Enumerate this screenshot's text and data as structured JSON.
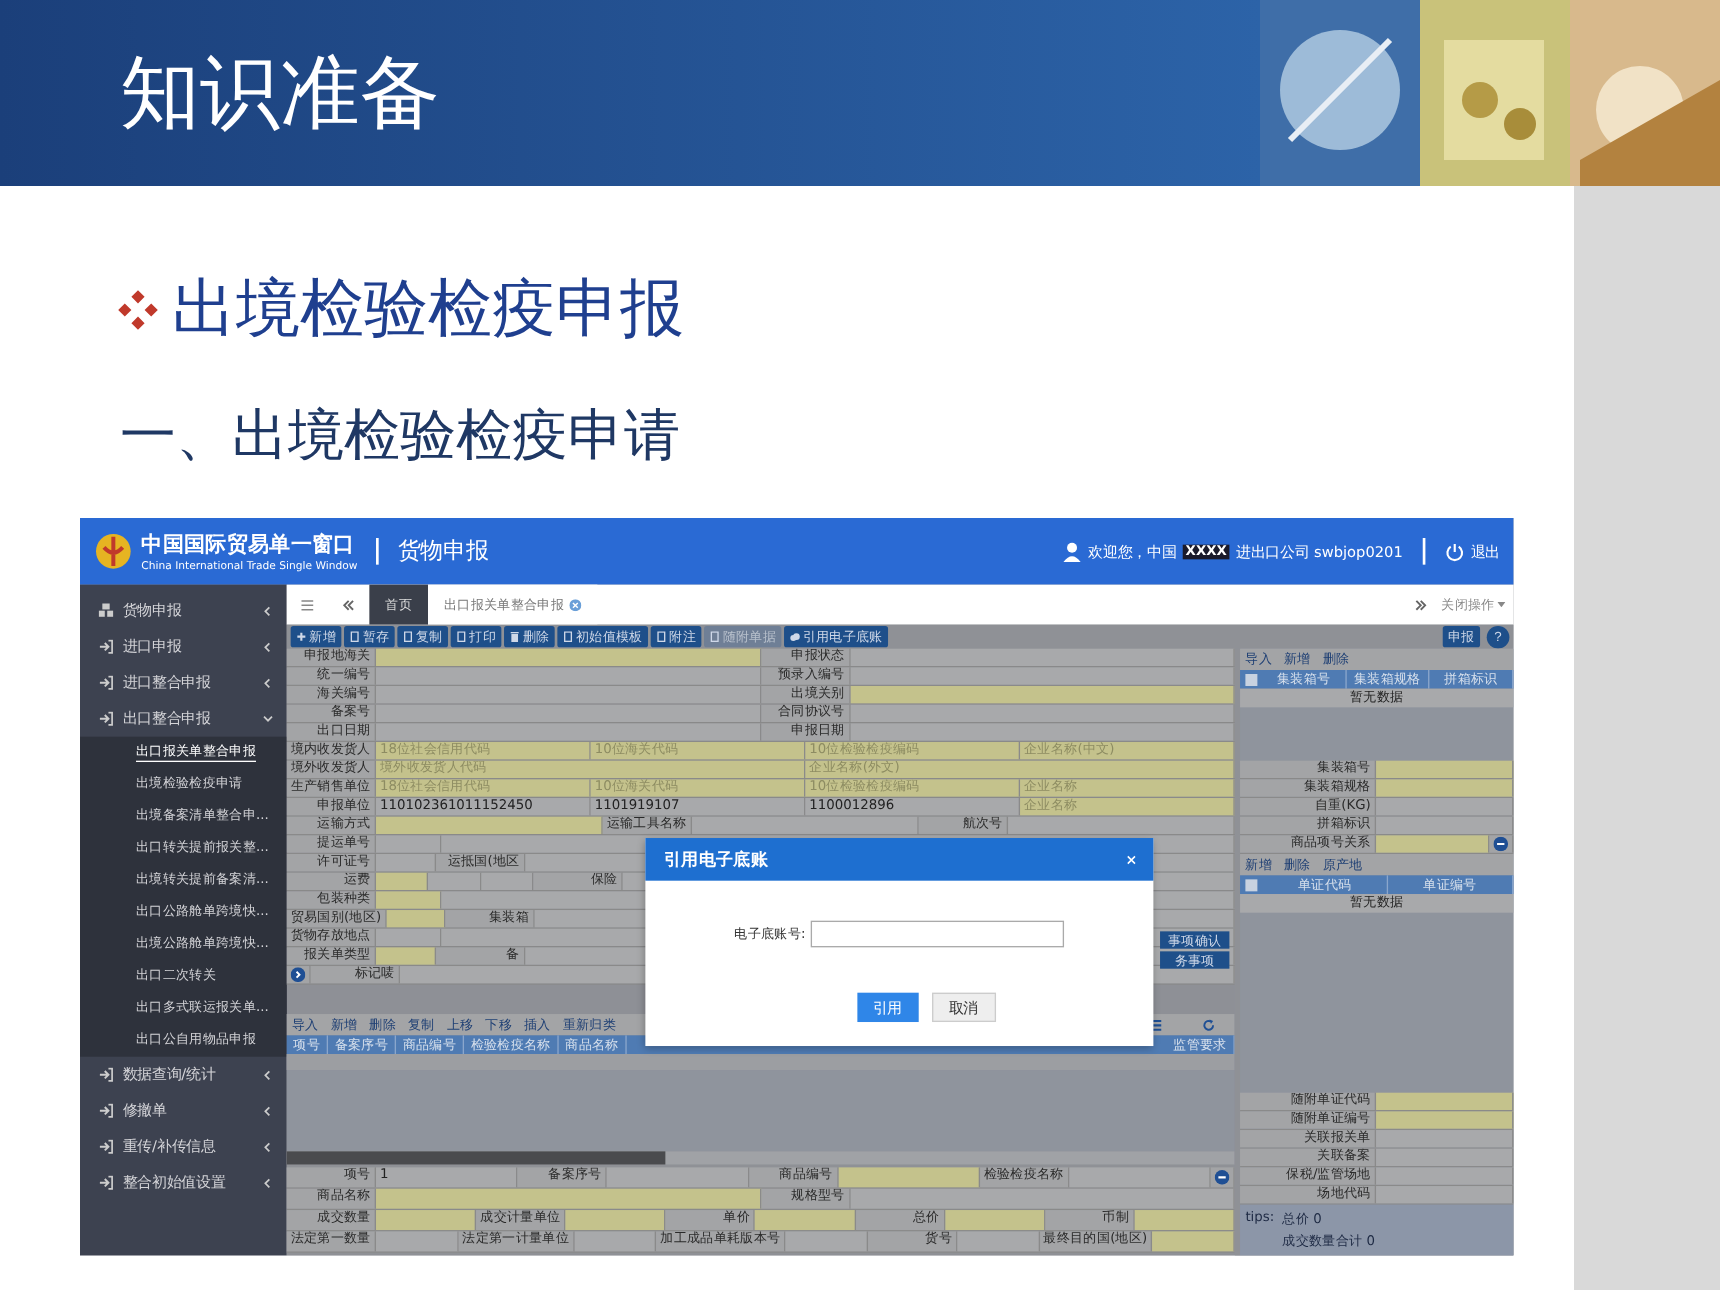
{
  "slide": {
    "title": "知识准备",
    "heading": "出境检验检疫申报",
    "subheading": "一、出境检验检疫申请"
  },
  "app": {
    "header": {
      "brand": "中国国际贸易单一窗口",
      "brand_en": "China International Trade Single Window",
      "module": "货物申报",
      "welcome": "欢迎您，中国",
      "masked": "XXXX",
      "account": "进出口公司 swbjop0201",
      "logout": "退出"
    },
    "sidebar": {
      "items": [
        {
          "label": "货物申报",
          "expanded": false
        },
        {
          "label": "进口申报",
          "expanded": false
        },
        {
          "label": "进口整合申报",
          "expanded": false
        },
        {
          "label": "出口整合申报",
          "expanded": true,
          "children": [
            {
              "label": "出口报关单整合申报",
              "selected": true
            },
            {
              "label": "出境检验检疫申请",
              "selected": false
            },
            {
              "label": "出境备案清单整合申...",
              "selected": false
            },
            {
              "label": "出口转关提前报关整...",
              "selected": false
            },
            {
              "label": "出境转关提前备案清...",
              "selected": false
            },
            {
              "label": "出口公路舱单跨境快...",
              "selected": false
            },
            {
              "label": "出境公路舱单跨境快...",
              "selected": false
            },
            {
              "label": "出口二次转关",
              "selected": false
            },
            {
              "label": "出口多式联运报关单...",
              "selected": false
            },
            {
              "label": "出口公自用物品申报",
              "selected": false
            }
          ]
        },
        {
          "label": "数据查询/统计",
          "expanded": false
        },
        {
          "label": "修撤单",
          "expanded": false
        },
        {
          "label": "重传/补传信息",
          "expanded": false
        },
        {
          "label": "整合初始值设置",
          "expanded": false
        }
      ]
    },
    "tabs": [
      {
        "label": "首页",
        "selected": false
      },
      {
        "label": "出口报关单整合申报",
        "selected": true
      }
    ],
    "close_menu": "关闭操作",
    "toolbar": [
      {
        "label": "新增",
        "disabled": false
      },
      {
        "label": "暂存",
        "disabled": false
      },
      {
        "label": "复制",
        "disabled": false
      },
      {
        "label": "打印",
        "disabled": false
      },
      {
        "label": "删除",
        "disabled": false
      },
      {
        "label": "初始值模板",
        "disabled": false
      },
      {
        "label": "附注",
        "disabled": false
      },
      {
        "label": "随附单据",
        "disabled": true
      },
      {
        "label": "引用电子底账",
        "disabled": false
      }
    ],
    "submit": "申报",
    "help": "?",
    "form": [
      {
        "cells": [
          {
            "kind": "label",
            "text": "申报地海关"
          },
          {
            "kind": "input"
          },
          {
            "kind": "label",
            "text": "申报状态"
          },
          {
            "kind": "field"
          }
        ]
      },
      {
        "cells": [
          {
            "kind": "label",
            "text": "统一编号"
          },
          {
            "kind": "field"
          },
          {
            "kind": "label",
            "text": "预录入编号"
          },
          {
            "kind": "field"
          }
        ]
      },
      {
        "cells": [
          {
            "kind": "label",
            "text": "海关编号"
          },
          {
            "kind": "field"
          },
          {
            "kind": "label",
            "text": "出境关别"
          },
          {
            "kind": "input"
          }
        ]
      },
      {
        "cells": [
          {
            "kind": "label",
            "text": "备案号"
          },
          {
            "kind": "field"
          },
          {
            "kind": "label",
            "text": "合同协议号"
          },
          {
            "kind": "field"
          }
        ]
      },
      {
        "cells": [
          {
            "kind": "label",
            "text": "出口日期"
          },
          {
            "kind": "field"
          },
          {
            "kind": "label",
            "text": "申报日期"
          },
          {
            "kind": "field"
          }
        ]
      },
      {
        "cells": [
          {
            "kind": "label",
            "text": "境内收发货人"
          },
          {
            "kind": "input",
            "placeholder": "18位社会信用代码"
          },
          {
            "kind": "input",
            "placeholder": "10位海关代码"
          },
          {
            "kind": "input",
            "placeholder": "10位检验检疫编码"
          },
          {
            "kind": "input",
            "placeholder": "企业名称(中文)"
          }
        ]
      },
      {
        "cells": [
          {
            "kind": "label",
            "text": "境外收发货人"
          },
          {
            "kind": "input",
            "placeholder": "境外收发货人代码"
          },
          {
            "kind": "input",
            "placeholder": "企业名称(外文)"
          }
        ]
      },
      {
        "cells": [
          {
            "kind": "label",
            "text": "生产销售单位"
          },
          {
            "kind": "input",
            "placeholder": "18位社会信用代码"
          },
          {
            "kind": "input",
            "placeholder": "10位海关代码"
          },
          {
            "kind": "input",
            "placeholder": "10位检验检疫编码"
          },
          {
            "kind": "input",
            "placeholder": "企业名称"
          }
        ]
      },
      {
        "cells": [
          {
            "kind": "label",
            "text": "申报单位"
          },
          {
            "kind": "field",
            "value": "110102361011152450"
          },
          {
            "kind": "field",
            "value": "1101919107"
          },
          {
            "kind": "field",
            "value": "1100012896"
          },
          {
            "kind": "input",
            "placeholder": "企业名称"
          }
        ]
      },
      {
        "cells": [
          {
            "kind": "label",
            "text": "运输方式"
          },
          {
            "kind": "input"
          },
          {
            "kind": "label",
            "text": "运输工具名称"
          },
          {
            "kind": "field"
          },
          {
            "kind": "label",
            "text": "航次号"
          },
          {
            "kind": "field"
          }
        ]
      },
      {
        "cells": [
          {
            "kind": "label",
            "text": "提运单号"
          },
          {
            "kind": "field"
          },
          {
            "kind": "covered"
          }
        ]
      },
      {
        "cells": [
          {
            "kind": "label",
            "text": "许可证号"
          },
          {
            "kind": "field"
          },
          {
            "kind": "label",
            "text": "运抵国(地区"
          },
          {
            "kind": "covered"
          }
        ]
      },
      {
        "cells": [
          {
            "kind": "label",
            "text": "运费"
          },
          {
            "kind": "input"
          },
          {
            "kind": "field"
          },
          {
            "kind": "field"
          },
          {
            "kind": "label",
            "text": "保险"
          },
          {
            "kind": "covered"
          }
        ]
      },
      {
        "cells": [
          {
            "kind": "label",
            "text": "包装种类"
          },
          {
            "kind": "input"
          },
          {
            "kind": "covered"
          }
        ]
      },
      {
        "cells": [
          {
            "kind": "label",
            "text": "贸易国别(地区)"
          },
          {
            "kind": "input"
          },
          {
            "kind": "label",
            "text": "集装箱"
          },
          {
            "kind": "covered"
          }
        ]
      },
      {
        "cells": [
          {
            "kind": "label",
            "text": "货物存放地点"
          },
          {
            "kind": "field"
          },
          {
            "kind": "covered"
          }
        ]
      },
      {
        "cells": [
          {
            "kind": "label",
            "text": "报关单类型"
          },
          {
            "kind": "input"
          },
          {
            "kind": "label",
            "text": "备"
          },
          {
            "kind": "covered"
          }
        ]
      },
      {
        "cells": [
          {
            "kind": "expander"
          },
          {
            "kind": "label",
            "text": "标记唛"
          },
          {
            "kind": "covered"
          }
        ]
      }
    ],
    "side_buttons": [
      "事项确认",
      "务事项"
    ],
    "goods_toolbar": [
      "导入",
      "新增",
      "删除",
      "复制",
      "上移",
      "下移",
      "插入",
      "重新归类"
    ],
    "goods_columns": [
      "项号",
      "备案序号",
      "商品编号",
      "检验检疫名称",
      "商品名称"
    ],
    "goods_columns_right": [
      "监管要求"
    ],
    "goods_form": [
      {
        "cells": [
          {
            "kind": "label",
            "text": "项号"
          },
          {
            "kind": "field",
            "value": "1"
          },
          {
            "kind": "label",
            "text": "备案序号"
          },
          {
            "kind": "field"
          },
          {
            "kind": "label",
            "text": "商品编号"
          },
          {
            "kind": "input"
          },
          {
            "kind": "label",
            "text": "检验检疫名称"
          },
          {
            "kind": "field"
          },
          {
            "kind": "remover"
          }
        ]
      },
      {
        "cells": [
          {
            "kind": "label",
            "text": "商品名称"
          },
          {
            "kind": "input"
          },
          {
            "kind": "label",
            "text": "规格型号"
          },
          {
            "kind": "field"
          }
        ]
      },
      {
        "cells": [
          {
            "kind": "label",
            "text": "成交数量"
          },
          {
            "kind": "input"
          },
          {
            "kind": "label",
            "text": "成交计量单位"
          },
          {
            "kind": "input"
          },
          {
            "kind": "label",
            "text": "单价"
          },
          {
            "kind": "input"
          },
          {
            "kind": "label",
            "text": "总价"
          },
          {
            "kind": "input"
          },
          {
            "kind": "label",
            "text": "币制"
          },
          {
            "kind": "input"
          }
        ]
      },
      {
        "cells": [
          {
            "kind": "label",
            "text": "法定第一数量"
          },
          {
            "kind": "field"
          },
          {
            "kind": "label",
            "text": "法定第一计量单位"
          },
          {
            "kind": "field"
          },
          {
            "kind": "label",
            "text": "加工成品单耗版本号"
          },
          {
            "kind": "field"
          },
          {
            "kind": "label",
            "text": "货号"
          },
          {
            "kind": "field"
          },
          {
            "kind": "label",
            "text": "最终目的国(地区)"
          },
          {
            "kind": "input"
          }
        ]
      }
    ],
    "right_panel": {
      "toolbar1": [
        "导入",
        "新增",
        "删除"
      ],
      "select_all": [
        {
          "checked": false
        },
        {
          "checked": false
        }
      ],
      "columns1": [
        "集装箱号",
        "集装箱规格",
        "拼箱标识"
      ],
      "empty1": "暂无数据",
      "fields1": [
        {
          "cells": [
            {
              "kind": "label",
              "text": "集装箱号"
            },
            {
              "kind": "input"
            }
          ]
        },
        {
          "cells": [
            {
              "kind": "label",
              "text": "集装箱规格"
            },
            {
              "kind": "input"
            }
          ]
        },
        {
          "cells": [
            {
              "kind": "label",
              "text": "自重(KG)"
            },
            {
              "kind": "field"
            }
          ]
        },
        {
          "cells": [
            {
              "kind": "label",
              "text": "拼箱标识"
            },
            {
              "kind": "field"
            }
          ]
        },
        {
          "cells": [
            {
              "kind": "label",
              "text": "商品项号关系"
            },
            {
              "kind": "input"
            },
            {
              "kind": "remover"
            }
          ]
        }
      ],
      "toolbar2": [
        "新增",
        "删除",
        "原产地"
      ],
      "columns2": [
        "单证代码",
        "单证编号"
      ],
      "empty2": "暂无数据",
      "fields2": [
        {
          "cells": [
            {
              "kind": "label",
              "text": "随附单证代码"
            },
            {
              "kind": "input"
            }
          ]
        },
        {
          "cells": [
            {
              "kind": "label",
              "text": "随附单证编号"
            },
            {
              "kind": "input"
            }
          ]
        },
        {
          "cells": [
            {
              "kind": "label",
              "text": "关联报关单"
            },
            {
              "kind": "field"
            }
          ]
        },
        {
          "cells": [
            {
              "kind": "label",
              "text": "关联备案"
            },
            {
              "kind": "field"
            }
          ]
        },
        {
          "cells": [
            {
              "kind": "label",
              "text": "保税/监管场地"
            },
            {
              "kind": "field"
            }
          ]
        },
        {
          "cells": [
            {
              "kind": "label",
              "text": "场地代码"
            },
            {
              "kind": "field"
            }
          ]
        }
      ],
      "tips_label": "tips:",
      "tips": [
        "总价 0",
        "成交数量合计 0"
      ]
    },
    "dialog": {
      "title": "引用电子底账",
      "field_label": "电子底账号:",
      "buttons": [
        {
          "label": "引用",
          "kind": "primary"
        },
        {
          "label": "取消",
          "kind": "secondary"
        }
      ]
    }
  }
}
